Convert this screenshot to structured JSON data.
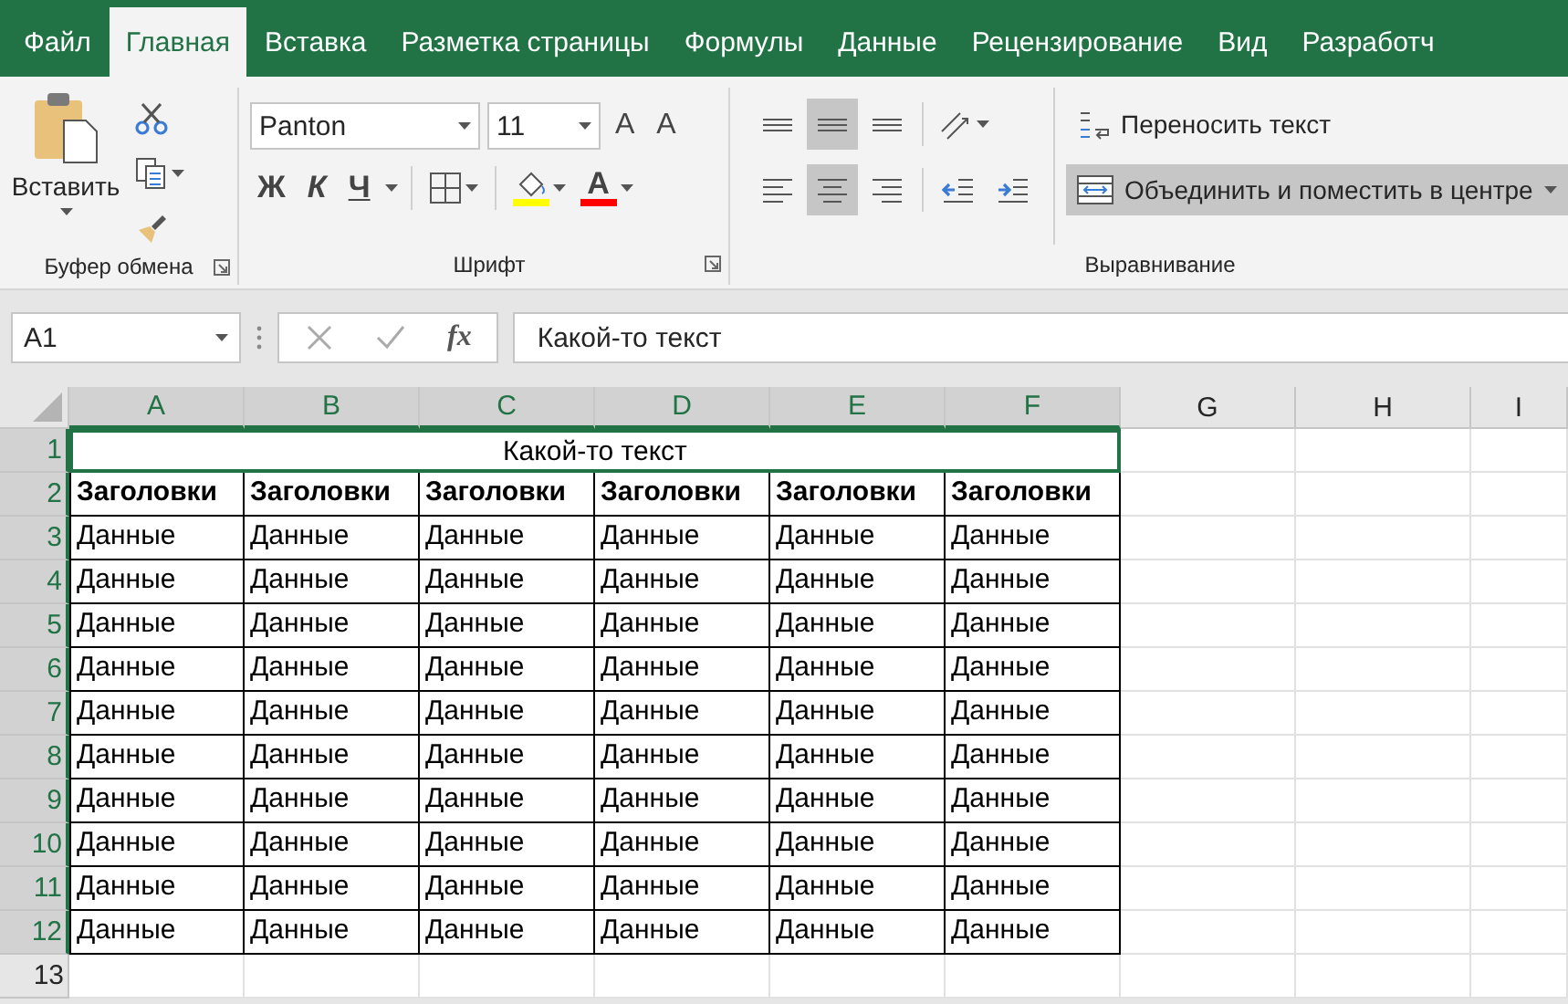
{
  "tabs": [
    {
      "label": "Файл",
      "selected": false
    },
    {
      "label": "Главная",
      "selected": true
    },
    {
      "label": "Вставка",
      "selected": false
    },
    {
      "label": "Разметка страницы",
      "selected": false
    },
    {
      "label": "Формулы",
      "selected": false
    },
    {
      "label": "Данные",
      "selected": false
    },
    {
      "label": "Рецензирование",
      "selected": false
    },
    {
      "label": "Вид",
      "selected": false
    },
    {
      "label": "Разработч",
      "selected": false
    }
  ],
  "ribbon": {
    "clipboard": {
      "paste_label": "Вставить",
      "group_label": "Буфер обмена"
    },
    "font": {
      "font_name": "Panton",
      "font_size": "11",
      "grow_glyph": "A",
      "shrink_glyph": "A",
      "bold_glyph": "Ж",
      "italic_glyph": "К",
      "underline_glyph": "Ч",
      "font_color_glyph": "A",
      "group_label": "Шрифт"
    },
    "alignment": {
      "vertical": [
        {
          "selected": false
        },
        {
          "selected": true
        },
        {
          "selected": false
        }
      ],
      "horizontal": [
        {
          "selected": false
        },
        {
          "selected": true
        },
        {
          "selected": false
        }
      ],
      "wrap_text": {
        "label": "Переносить текст",
        "selected": false
      },
      "merge_center": {
        "label": "Объединить и поместить в центре",
        "selected": true
      },
      "group_label": "Выравнивание"
    }
  },
  "formula_bar": {
    "name_box": "A1",
    "fx": "fx",
    "formula": "Какой-то текст"
  },
  "sheet": {
    "columns": [
      {
        "label": "A",
        "selected": true
      },
      {
        "label": "B",
        "selected": true
      },
      {
        "label": "C",
        "selected": true
      },
      {
        "label": "D",
        "selected": true
      },
      {
        "label": "E",
        "selected": true
      },
      {
        "label": "F",
        "selected": true
      },
      {
        "label": "G",
        "selected": false
      },
      {
        "label": "H",
        "selected": false
      },
      {
        "label": "I",
        "selected": false
      }
    ],
    "rows": [
      {
        "number": "1",
        "selected": true,
        "kind": "merged",
        "active": true,
        "text": "Какой-то текст"
      },
      {
        "number": "2",
        "selected": true,
        "kind": "header",
        "cells": [
          "Заголовки",
          "Заголовки",
          "Заголовки",
          "Заголовки",
          "Заголовки",
          "Заголовки"
        ]
      },
      {
        "number": "3",
        "selected": true,
        "kind": "data",
        "cells": [
          "Данные",
          "Данные",
          "Данные",
          "Данные",
          "Данные",
          "Данные"
        ]
      },
      {
        "number": "4",
        "selected": true,
        "kind": "data",
        "cells": [
          "Данные",
          "Данные",
          "Данные",
          "Данные",
          "Данные",
          "Данные"
        ]
      },
      {
        "number": "5",
        "selected": true,
        "kind": "data",
        "cells": [
          "Данные",
          "Данные",
          "Данные",
          "Данные",
          "Данные",
          "Данные"
        ]
      },
      {
        "number": "6",
        "selected": true,
        "kind": "data",
        "cells": [
          "Данные",
          "Данные",
          "Данные",
          "Данные",
          "Данные",
          "Данные"
        ]
      },
      {
        "number": "7",
        "selected": true,
        "kind": "data",
        "cells": [
          "Данные",
          "Данные",
          "Данные",
          "Данные",
          "Данные",
          "Данные"
        ]
      },
      {
        "number": "8",
        "selected": true,
        "kind": "data",
        "cells": [
          "Данные",
          "Данные",
          "Данные",
          "Данные",
          "Данные",
          "Данные"
        ]
      },
      {
        "number": "9",
        "selected": true,
        "kind": "data",
        "cells": [
          "Данные",
          "Данные",
          "Данные",
          "Данные",
          "Данные",
          "Данные"
        ]
      },
      {
        "number": "10",
        "selected": true,
        "kind": "data",
        "cells": [
          "Данные",
          "Данные",
          "Данные",
          "Данные",
          "Данные",
          "Данные"
        ]
      },
      {
        "number": "11",
        "selected": true,
        "kind": "data",
        "cells": [
          "Данные",
          "Данные",
          "Данные",
          "Данные",
          "Данные",
          "Данные"
        ]
      },
      {
        "number": "12",
        "selected": true,
        "kind": "data",
        "cells": [
          "Данные",
          "Данные",
          "Данные",
          "Данные",
          "Данные",
          "Данные"
        ]
      },
      {
        "number": "13",
        "selected": false,
        "kind": "empty"
      }
    ]
  }
}
